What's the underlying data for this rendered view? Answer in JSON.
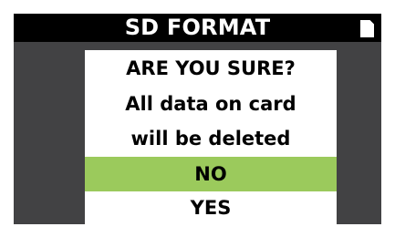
{
  "header": {
    "title": "SD FORMAT",
    "status_icon": "sd-card-icon"
  },
  "dialog": {
    "heading": "ARE YOU SURE?",
    "message_line1": "All data on card",
    "message_line2": "will be deleted",
    "options": [
      {
        "label": "NO",
        "selected": true
      },
      {
        "label": "YES",
        "selected": false
      }
    ]
  },
  "colors": {
    "screen_background": "#424244",
    "title_background": "#000000",
    "dialog_background": "#ffffff",
    "selected_option": "#9bca5c"
  }
}
